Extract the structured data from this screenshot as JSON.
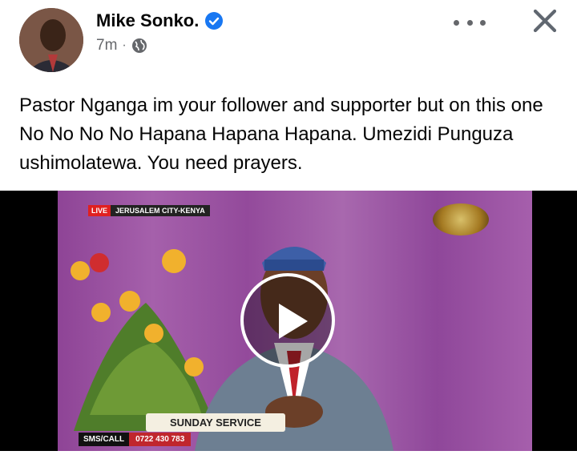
{
  "post": {
    "author": "Mike Sonko.",
    "time": "7m",
    "separator": "·",
    "visibility_icon": "globe-icon",
    "text": "Pastor Nganga im your follower and supporter but on this one No No No No Hapana Hapana Hapana. Umezidi Punguza ushimolatewa. You need prayers."
  },
  "video": {
    "overlay_live": "LIVE",
    "overlay_location": "JERUSALEM CITY-KENYA",
    "overlay_title": "SUNDAY SERVICE",
    "overlay_sms": "SMS/CALL",
    "overlay_phone": "0722 430 783"
  },
  "colors": {
    "verified": "#1877f2",
    "meta_text": "#65676b",
    "curtain": "#9a4fa0"
  }
}
